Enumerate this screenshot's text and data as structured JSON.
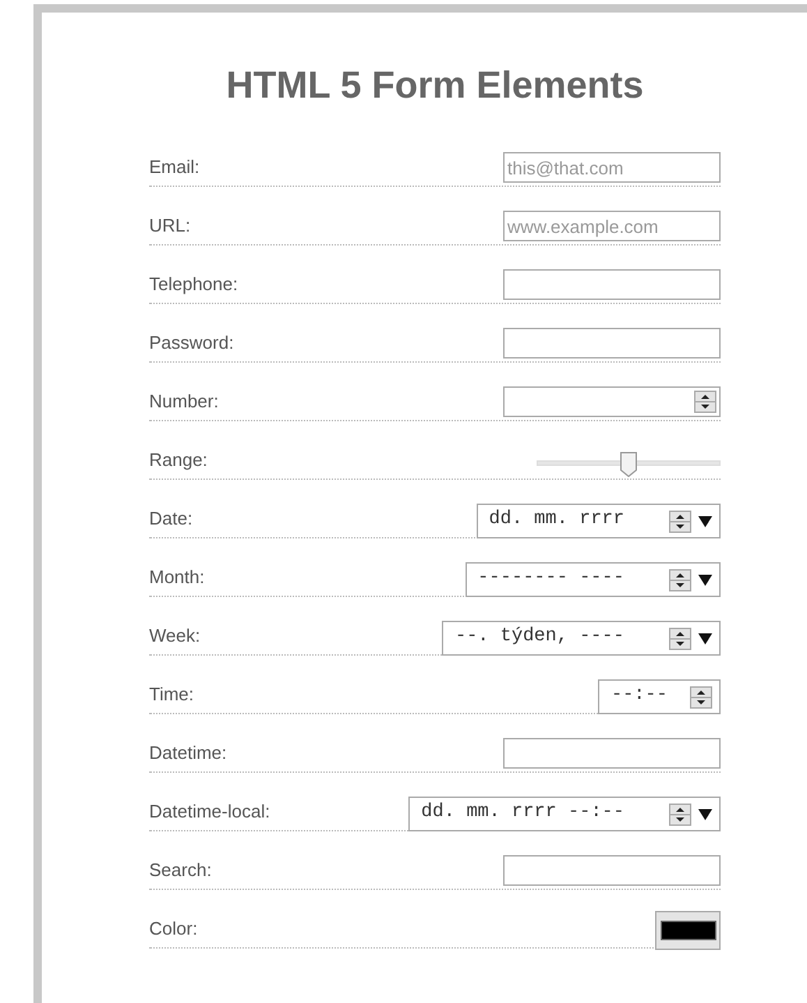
{
  "title": "HTML 5 Form Elements",
  "fields": [
    {
      "label": "Email:",
      "kind": "text",
      "placeholder": "this@that.com"
    },
    {
      "label": "URL:",
      "kind": "text",
      "placeholder": "www.example.com"
    },
    {
      "label": "Telephone:",
      "kind": "text"
    },
    {
      "label": "Password:",
      "kind": "text"
    },
    {
      "label": "Number:",
      "kind": "number"
    },
    {
      "label": "Range:",
      "kind": "range",
      "level": 0.5
    },
    {
      "label": "Date:",
      "kind": "datetime",
      "value": "dd. mm. rrrr",
      "dropdown": true
    },
    {
      "label": "Month:",
      "kind": "datetime",
      "value": "-------- ----",
      "dropdown": true
    },
    {
      "label": "Week:",
      "kind": "datetime",
      "value": "--. týden, ----",
      "dropdown": true
    },
    {
      "label": "Time:",
      "kind": "datetime",
      "value": "--:--",
      "dropdown": false
    },
    {
      "label": "Datetime:",
      "kind": "text"
    },
    {
      "label": "Datetime-local:",
      "kind": "datetime",
      "value": "dd. mm. rrrr --:--",
      "dropdown": true
    },
    {
      "label": "Search:",
      "kind": "text"
    },
    {
      "label": "Color:",
      "kind": "color",
      "color": "#000000"
    }
  ]
}
